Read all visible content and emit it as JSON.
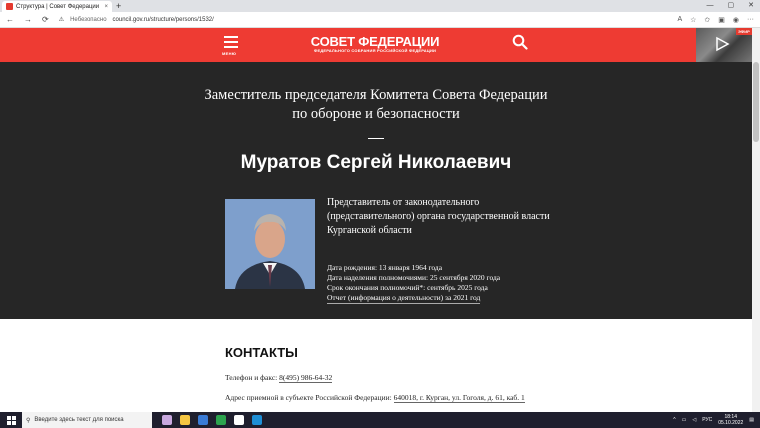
{
  "browser": {
    "tab_title": "Структура | Совет Федерации",
    "tab_close": "×",
    "new_tab": "+",
    "win_min": "—",
    "win_max": "▢",
    "win_close": "✕",
    "back": "←",
    "forward": "→",
    "reload": "⟳",
    "not_secure": "Небезопасно",
    "url": "council.gov.ru/structure/persons/1532/",
    "more": "···"
  },
  "header": {
    "menu_label": "МЕНЮ",
    "logo_title": "СОВЕТ ФЕДЕРАЦИИ",
    "logo_subtitle": "ФЕДЕРАЛЬНОГО СОБРАНИЯ РОССИЙСКОЙ ФЕДЕРАЦИИ",
    "live_badge": "ЭФИР"
  },
  "person": {
    "position": "Заместитель председателя Комитета Совета Федерации по обороне и безопасности",
    "name": "Муратов Сергей Николаевич",
    "representative": "Представитель от законодательного (представительного) органа государственной власти Курганской области",
    "birth": "Дата рождения: 13 января 1964 года",
    "appointed": "Дата наделения полномочиями: 25 сентября 2020 года",
    "term_end": "Срок окончания полномочий*: сентябрь 2025 года",
    "report": "Отчет (информация о деятельности) за 2021 год"
  },
  "contacts": {
    "heading": "КОНТАКТЫ",
    "phone_label": "Телефон и факс: ",
    "phone_value": "8(495) 986-64-32",
    "address_label": "Адрес приемной в субъекте Российской Федерации: ",
    "address_value": "640018, г. Курган, ул. Гоголя, д. 61, каб. 1"
  },
  "taskbar": {
    "search_placeholder": "Введите здесь текст для поиска",
    "lang": "РУС",
    "time": "18:14",
    "date": "05.10.2022"
  },
  "colors": {
    "brand_red": "#ee3b33",
    "hero_bg": "#262626"
  }
}
